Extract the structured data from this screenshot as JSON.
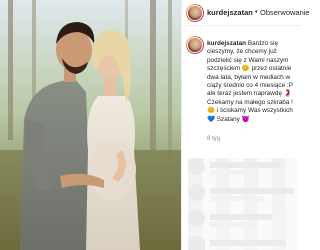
{
  "post": {
    "username": "kurdejszatan",
    "header_separator": "•",
    "follow_label": "Obserwowanie",
    "caption_username": "kurdejszatan",
    "caption_text": "Bardzo się cieszymy, że chcemy już podzielić się z Wami naszym szczęściem 😊 przez ostatnie dwa lata, byłam w mediach w ciąży średnio co 4 miesiące :P ale teraz jestem naprawdę 🤰 Czekamy na małego szkraba ! 😊 i ściskamy Was wszystkich 💙 Szatany 😈",
    "time_ago": "6 tyg."
  },
  "icons": {
    "avatar": "profile-avatar-icon",
    "comment_avatar": "comment-avatar-placeholder-icon"
  },
  "colors": {
    "link": "#262626",
    "muted": "#8e8e8e",
    "placeholder": "#ededed"
  }
}
